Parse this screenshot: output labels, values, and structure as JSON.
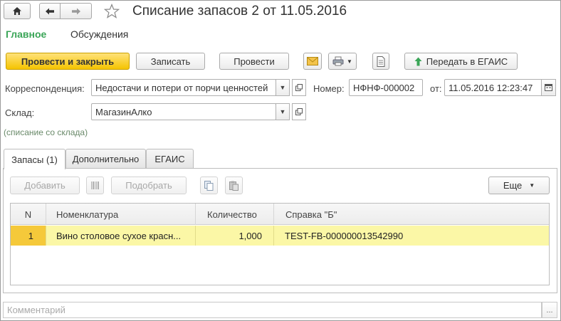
{
  "window": {
    "title": "Списание запасов 2 от 11.05.2016"
  },
  "nav": {
    "home_icon": "home-icon",
    "back_icon": "arrow-left-icon",
    "forward_icon": "arrow-right-icon",
    "favorite_icon": "star-icon"
  },
  "tabs_top": {
    "main": "Главное",
    "discussions": "Обсуждения"
  },
  "toolbar": {
    "post_close": "Провести и закрыть",
    "save": "Записать",
    "post": "Провести",
    "send_egais": "Передать в ЕГАИС"
  },
  "form": {
    "correspondence_label": "Корреспонденция:",
    "correspondence_value": "Недостачи и потери от порчи ценностей",
    "number_label": "Номер:",
    "number_value": "НФНФ-000002",
    "date_label": "от:",
    "date_value": "11.05.2016 12:23:47",
    "warehouse_label": "Склад:",
    "warehouse_value": "МагазинАлко",
    "hint": "(списание со склада)"
  },
  "tabs": {
    "stock": "Запасы (1)",
    "additional": "Дополнительно",
    "egais": "ЕГАИС"
  },
  "table_toolbar": {
    "add": "Добавить",
    "pick": "Подобрать",
    "more": "Еще"
  },
  "table": {
    "columns": [
      "N",
      "Номенклатура",
      "Количество",
      "Справка \"Б\""
    ],
    "rows": [
      {
        "n": "1",
        "item": "Вино столовое сухое красн...",
        "qty": "1,000",
        "ref_b": "TEST-FB-000000013542990"
      }
    ]
  },
  "comment": {
    "placeholder": "Комментарий",
    "button": "..."
  },
  "colors": {
    "accent_green": "#3aa557",
    "primary_button": "#f5c400",
    "selected_row": "#fbf7a6"
  }
}
